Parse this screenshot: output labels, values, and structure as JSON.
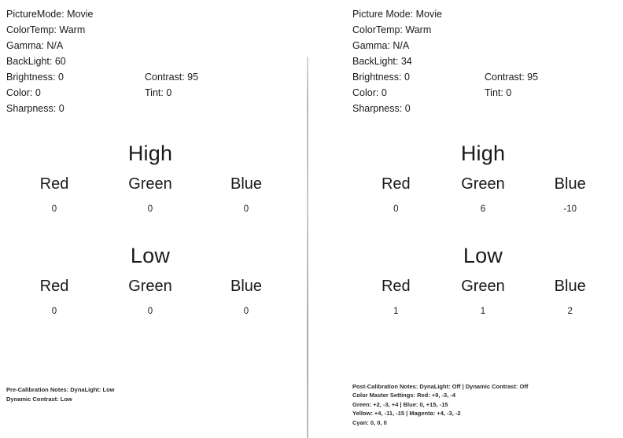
{
  "left_panel": {
    "settings": {
      "picture_mode_label": "PictureMode: Movie",
      "color_temp_label": "ColorTemp: Warm",
      "gamma_label": "Gamma: N/A",
      "backlight_label": "BackLight: 60",
      "brightness_label": "Brightness: 0",
      "contrast_label": "Contrast: 95",
      "color_label": "Color: 0",
      "tint_label": "Tint: 0",
      "sharpness_label": "Sharpness: 0"
    },
    "high": {
      "title": "High",
      "channels": [
        {
          "label": "Red",
          "value": "0"
        },
        {
          "label": "Green",
          "value": "0"
        },
        {
          "label": "Blue",
          "value": "0"
        }
      ]
    },
    "low": {
      "title": "Low",
      "channels": [
        {
          "label": "Red",
          "value": "0"
        },
        {
          "label": "Green",
          "value": "0"
        },
        {
          "label": "Blue",
          "value": "0"
        }
      ]
    },
    "notes": [
      "Pre-Calibration Notes: DynaLight: Low",
      "Dynamic Contrast: Low"
    ]
  },
  "right_panel": {
    "settings": {
      "picture_mode_label": "Picture Mode: Movie",
      "color_temp_label": "ColorTemp: Warm",
      "gamma_label": "Gamma: N/A",
      "backlight_label": "BackLight: 34",
      "brightness_label": "Brightness: 0",
      "contrast_label": "Contrast: 95",
      "color_label": "Color: 0",
      "tint_label": "Tint: 0",
      "sharpness_label": "Sharpness: 0"
    },
    "high": {
      "title": "High",
      "channels": [
        {
          "label": "Red",
          "value": "0"
        },
        {
          "label": "Green",
          "value": "6"
        },
        {
          "label": "Blue",
          "value": "-10"
        }
      ]
    },
    "low": {
      "title": "Low",
      "channels": [
        {
          "label": "Red",
          "value": "1"
        },
        {
          "label": "Green",
          "value": "1"
        },
        {
          "label": "Blue",
          "value": "2"
        }
      ]
    },
    "notes": [
      "Post-Calibration Notes: DynaLight: Off | Dynamic Contrast: Off",
      "Color Master Settings: Red: +9, -3, -4",
      "Green: +2, -3, +4 | Blue: 0, +15, -15",
      "Yellow: +4, -11, -15 | Magenta: +4, -3, -2",
      "Cyan: 0, 0, 0"
    ]
  }
}
